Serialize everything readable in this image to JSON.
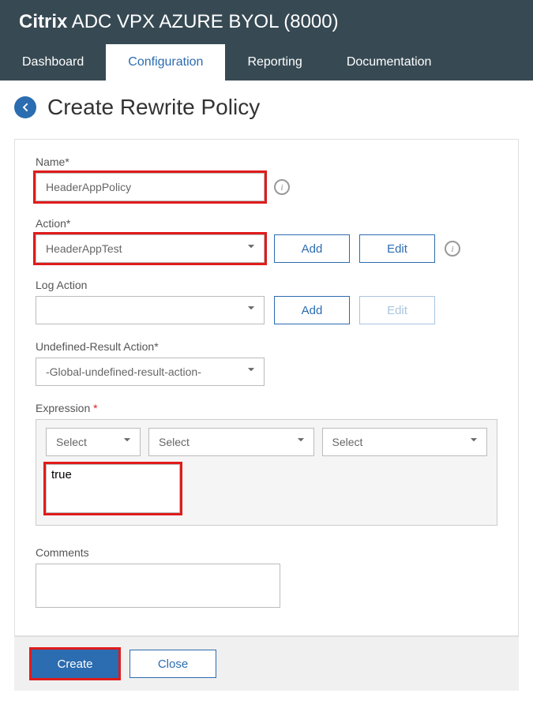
{
  "header": {
    "brand": "Citrix",
    "product": " ADC VPX AZURE BYOL (8000)"
  },
  "tabs": [
    {
      "label": "Dashboard",
      "active": false
    },
    {
      "label": "Configuration",
      "active": true
    },
    {
      "label": "Reporting",
      "active": false
    },
    {
      "label": "Documentation",
      "active": false
    }
  ],
  "page": {
    "title": "Create Rewrite Policy"
  },
  "form": {
    "name": {
      "label": "Name*",
      "value": "HeaderAppPolicy"
    },
    "action": {
      "label": "Action*",
      "value": "HeaderAppTest",
      "add_label": "Add",
      "edit_label": "Edit"
    },
    "log_action": {
      "label": "Log Action",
      "value": "",
      "add_label": "Add",
      "edit_label": "Edit"
    },
    "undefined_result": {
      "label": "Undefined-Result Action*",
      "value": "-Global-undefined-result-action-"
    },
    "expression": {
      "label": "Expression ",
      "star": "*",
      "select_placeholder": "Select",
      "value": "true"
    },
    "comments": {
      "label": "Comments",
      "value": ""
    }
  },
  "footer": {
    "create_label": "Create",
    "close_label": "Close"
  },
  "info_glyph": "i"
}
